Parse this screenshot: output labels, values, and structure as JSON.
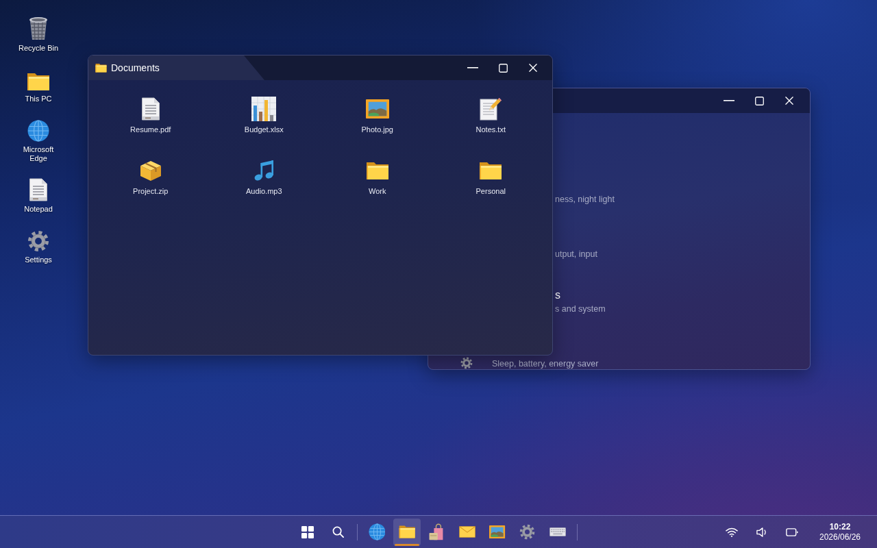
{
  "desktop": {
    "shortcuts": [
      {
        "label": "Recycle Bin",
        "kind": "trash"
      },
      {
        "label": "This PC",
        "kind": "folder"
      },
      {
        "label": "Microsoft Edge",
        "kind": "globe"
      },
      {
        "label": "Notepad",
        "kind": "document"
      },
      {
        "label": "Settings",
        "kind": "gear"
      }
    ]
  },
  "back_window": {
    "rows": [
      {
        "kind": "covered",
        "description": "ness, night light"
      },
      {
        "kind": "covered",
        "description": "utput, input"
      },
      {
        "kind": "covered",
        "title": "s",
        "description": "s and system"
      },
      {
        "kind": "full",
        "description": "Sleep, battery, energy saver"
      }
    ]
  },
  "documents_window": {
    "title": "Documents",
    "files": [
      {
        "name": "Resume.pdf",
        "kind": "document"
      },
      {
        "name": "Budget.xlsx",
        "kind": "chart"
      },
      {
        "name": "Photo.jpg",
        "kind": "picture"
      },
      {
        "name": "Notes.txt",
        "kind": "notepad"
      },
      {
        "name": "Project.zip",
        "kind": "package"
      },
      {
        "name": "Audio.mp3",
        "kind": "music"
      },
      {
        "name": "Work",
        "kind": "folder"
      },
      {
        "name": "Personal",
        "kind": "folder"
      }
    ]
  },
  "taskbar": {
    "apps": [
      {
        "kind": "globe",
        "selected": false
      },
      {
        "kind": "folder",
        "selected": true
      },
      {
        "kind": "bag",
        "selected": false
      },
      {
        "kind": "envelope",
        "selected": false
      },
      {
        "kind": "picture",
        "selected": false
      },
      {
        "kind": "gear",
        "selected": false
      },
      {
        "kind": "keyboard",
        "selected": false
      }
    ],
    "clock": {
      "time": "10:22",
      "date": "2026/06/26"
    }
  }
}
